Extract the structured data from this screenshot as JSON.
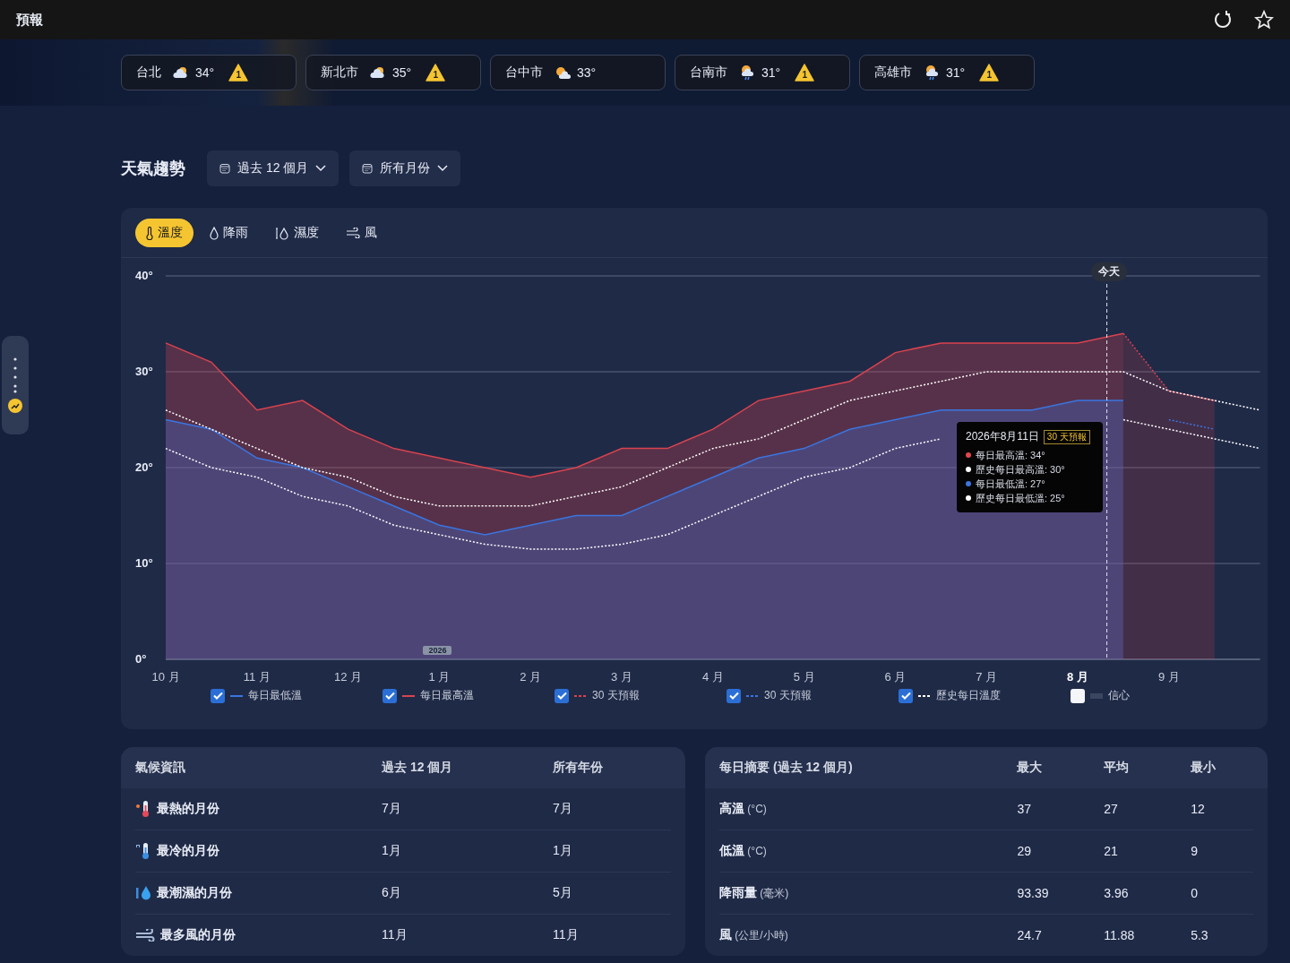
{
  "top_bar": {
    "title": "預報"
  },
  "cities": [
    {
      "name": "台北",
      "kind": "partly-cloudy",
      "temp": "34°",
      "alert": "1"
    },
    {
      "name": "新北市",
      "kind": "partly-cloudy",
      "temp": "35°",
      "alert": "1"
    },
    {
      "name": "台中市",
      "kind": "sun-cloud",
      "temp": "33°"
    },
    {
      "name": "台南市",
      "kind": "showers",
      "temp": "31°",
      "alert": "1"
    },
    {
      "name": "高雄市",
      "kind": "showers",
      "temp": "31°",
      "alert": "1"
    }
  ],
  "trends": {
    "title": "天氣趨勢",
    "dropdowns": [
      {
        "label": "過去 12 個月"
      },
      {
        "label": "所有月份"
      }
    ],
    "tabs": [
      {
        "label": "溫度",
        "kind": "temperature",
        "selected": true
      },
      {
        "label": "降雨",
        "kind": "rain",
        "selected": false
      },
      {
        "label": "濕度",
        "kind": "humidity",
        "selected": false
      },
      {
        "label": "風",
        "kind": "wind",
        "selected": false
      }
    ],
    "today_label": "今天",
    "year_tag": "2026",
    "chart_data": {
      "type": "area",
      "ylim": [
        0,
        40
      ],
      "grid": true,
      "categories": [
        "10 月",
        null,
        "11 月",
        null,
        "12 月",
        null,
        "1 月",
        null,
        "2 月",
        null,
        "3 月",
        null,
        "4 月",
        null,
        "5 月",
        null,
        "6 月",
        null,
        "7 月",
        null,
        "8 月",
        null,
        "9 月",
        null,
        null
      ],
      "yticks": [
        {
          "value": 0,
          "label": "0°"
        },
        {
          "value": 10,
          "label": "10°"
        },
        {
          "value": 20,
          "label": "20°"
        },
        {
          "value": 30,
          "label": "30°"
        },
        {
          "value": 40,
          "label": "40°"
        }
      ],
      "series": [
        {
          "color": "#d9434f",
          "values": [
            33,
            31,
            26,
            27,
            24,
            22,
            21,
            20,
            19,
            20,
            22,
            22,
            24,
            27,
            28,
            29,
            32,
            33,
            33,
            33,
            33,
            34,
            null,
            null,
            null
          ]
        },
        {
          "color": "#3a75e0",
          "values": [
            25,
            24,
            21,
            20,
            18,
            16,
            14,
            13,
            14,
            15,
            15,
            17,
            19,
            21,
            22,
            24,
            25,
            26,
            26,
            26,
            27,
            27,
            null,
            null,
            null
          ]
        },
        {
          "color": "#d9434f",
          "line_style": "dotted",
          "values": [
            null,
            null,
            null,
            null,
            null,
            null,
            null,
            null,
            null,
            null,
            null,
            null,
            null,
            null,
            null,
            null,
            null,
            null,
            null,
            null,
            null,
            34,
            28,
            27,
            null
          ]
        },
        {
          "color": "#3a75e0",
          "type": "line",
          "line_style": "dotted",
          "values": [
            null,
            null,
            null,
            null,
            null,
            null,
            null,
            null,
            null,
            null,
            null,
            null,
            null,
            null,
            null,
            null,
            null,
            null,
            null,
            null,
            null,
            null,
            25,
            24,
            null
          ]
        },
        {
          "color": "#ffffff",
          "type": "line",
          "line_style": "dotted",
          "values": [
            26,
            24,
            22,
            20,
            19,
            17,
            16,
            16,
            16,
            17,
            18,
            20,
            22,
            23,
            25,
            27,
            28,
            29,
            30,
            30,
            30,
            30,
            28,
            27,
            26
          ]
        },
        {
          "color": "#ffffff",
          "type": "line",
          "line_style": "dotted",
          "values": [
            22,
            20,
            19,
            17,
            16,
            14,
            13,
            12,
            11.5,
            11.5,
            12,
            13,
            15,
            17,
            19,
            20,
            22,
            23,
            null,
            null,
            null,
            25,
            24,
            23,
            22
          ]
        }
      ]
    },
    "tooltip": {
      "date": "2026年8月11日",
      "badge": "30 天預報",
      "rows": [
        {
          "text": "每日最高溫: 34°",
          "color": "#e0474f"
        },
        {
          "text": "歷史每日最高溫: 30°",
          "color": "#ffffff"
        },
        {
          "text": "每日最低溫: 27°",
          "color": "#3a75e0"
        },
        {
          "text": "歷史每日最低溫: 25°",
          "color": "#ffffff"
        }
      ]
    },
    "legend": [
      {
        "label": "每日最低溫",
        "checked": true,
        "color": "#3a75e0",
        "kind": "solid"
      },
      {
        "label": "每日最高溫",
        "checked": true,
        "color": "#d9434f",
        "kind": "solid"
      },
      {
        "label": "30 天預報",
        "checked": true,
        "color": "#d9434f",
        "kind": "dotted"
      },
      {
        "label": "30 天預報",
        "checked": true,
        "color": "#3a75e0",
        "kind": "dotted"
      },
      {
        "label": "歷史每日溫度",
        "checked": true,
        "color": "#ffffff",
        "kind": "dotted"
      },
      {
        "label": "信心",
        "checked": false,
        "color": "#3a4560",
        "kind": "band"
      }
    ]
  },
  "climate_table": {
    "columns": [
      "氣候資訊",
      "過去 12 個月",
      "所有年份"
    ],
    "rows": [
      {
        "kind": "hot",
        "cells": [
          "最熱的月份",
          "7月",
          "7月"
        ]
      },
      {
        "kind": "cold",
        "cells": [
          "最冷的月份",
          "1月",
          "1月"
        ]
      },
      {
        "kind": "wet",
        "cells": [
          "最潮濕的月份",
          "6月",
          "5月"
        ]
      },
      {
        "kind": "windy",
        "cells": [
          "最多風的月份",
          "11月",
          "11月"
        ]
      }
    ]
  },
  "daily_summary": {
    "columns": [
      "每日摘要 (過去 12 個月)",
      "最大",
      "平均",
      "最小"
    ],
    "rows": [
      {
        "cells": [
          "**高溫** (°C)",
          "37",
          "27",
          "12"
        ]
      },
      {
        "cells": [
          "**低溫** (°C)",
          "29",
          "21",
          "9"
        ]
      },
      {
        "cells": [
          "**降雨量** (毫米)",
          "93.39",
          "3.96",
          "0"
        ]
      },
      {
        "cells": [
          "**風** (公里/小時)",
          "24.7",
          "11.88",
          "5.3"
        ]
      }
    ]
  }
}
